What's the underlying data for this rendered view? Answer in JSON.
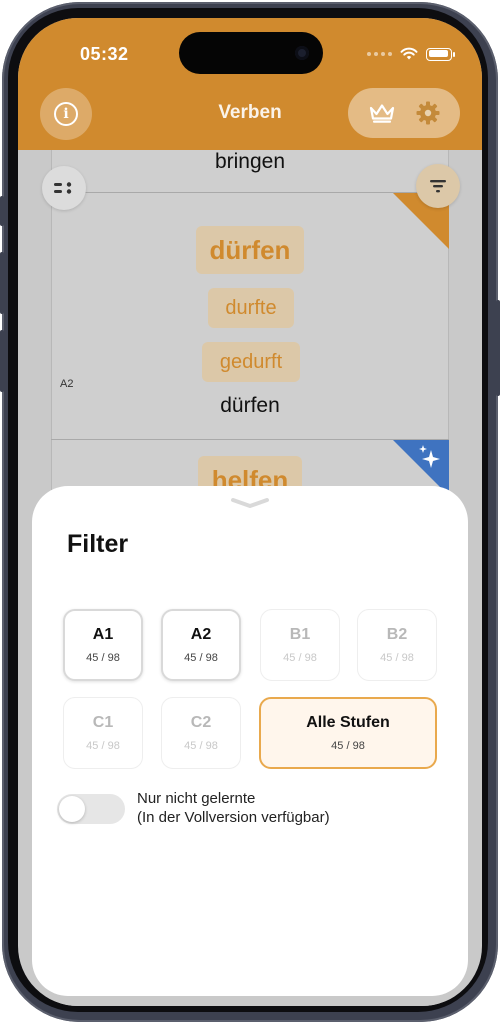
{
  "status_bar": {
    "time": "05:32"
  },
  "header": {
    "title": "Verben",
    "accent_color": "#d08a2e"
  },
  "cards": {
    "previous_word": "bringen",
    "current": {
      "infinitive": "dürfen",
      "praeteritum": "durfte",
      "partizip": "gedurft",
      "level": "A2",
      "translation_word": "dürfen"
    },
    "next": {
      "infinitive": "helfen"
    }
  },
  "filter": {
    "title": "Filter",
    "levels": [
      {
        "name": "A1",
        "count": "45 / 98",
        "state": "enabled"
      },
      {
        "name": "A2",
        "count": "45 / 98",
        "state": "enabled"
      },
      {
        "name": "B1",
        "count": "45 / 98",
        "state": "disabled"
      },
      {
        "name": "B2",
        "count": "45 / 98",
        "state": "disabled"
      },
      {
        "name": "C1",
        "count": "45 / 98",
        "state": "disabled"
      },
      {
        "name": "C2",
        "count": "45 / 98",
        "state": "disabled"
      },
      {
        "name": "Alle Stufen",
        "count": "45 / 98",
        "state": "selected"
      }
    ],
    "toggle": {
      "label_line1": "Nur nicht gelernte",
      "label_line2": "(In der Vollversion verfügbar)",
      "on": false
    }
  },
  "icons": [
    "info-icon",
    "crown-icon",
    "gear-icon",
    "dots-icon",
    "filter-icon",
    "bookmark-icon",
    "sparkle-icon",
    "chevron-down-icon",
    "wifi-icon",
    "battery-icon"
  ]
}
